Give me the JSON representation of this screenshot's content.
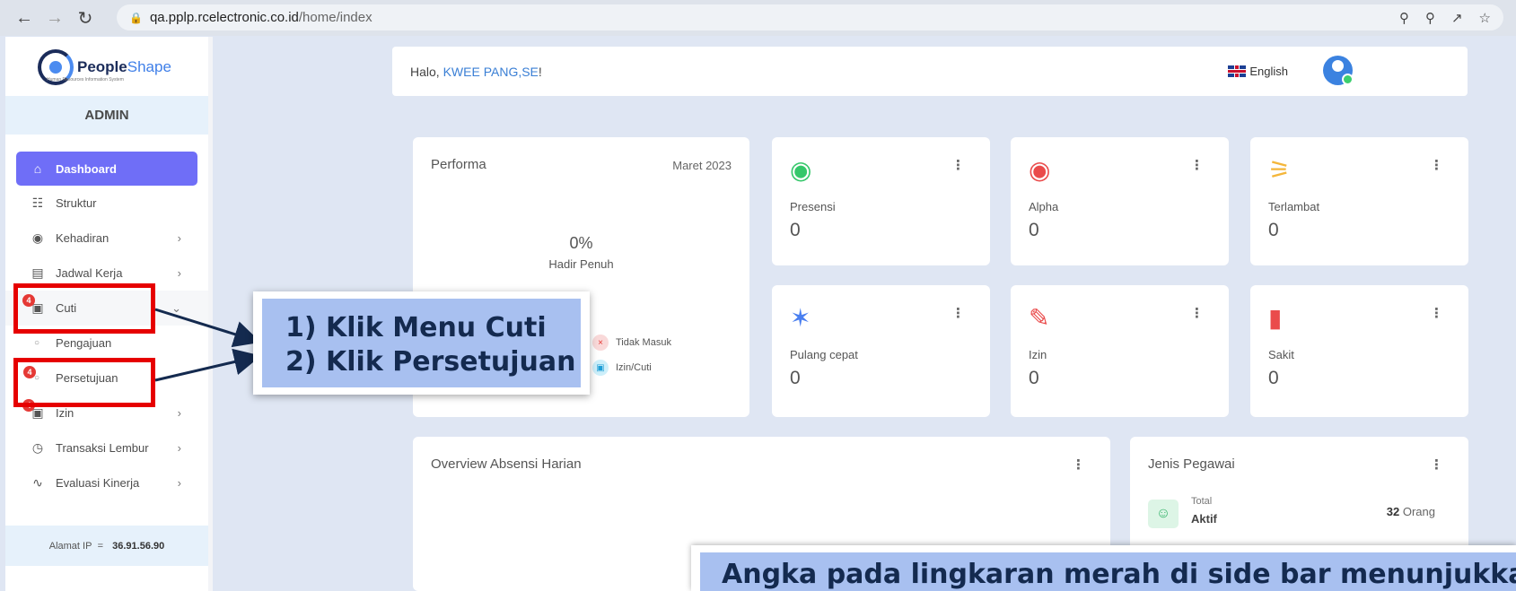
{
  "browser": {
    "url_domain": "qa.pplp.rcelectronic.co.id",
    "url_path": "/home/index"
  },
  "sidebar": {
    "logo_text_a": "People",
    "logo_text_b": "Shape",
    "logo_sub": "Human Resources Information System",
    "role": "ADMIN",
    "items": [
      {
        "label": "Dashboard",
        "icon": "home-icon"
      },
      {
        "label": "Struktur",
        "icon": "org-chart-icon"
      },
      {
        "label": "Kehadiran",
        "icon": "fingerprint-icon"
      },
      {
        "label": "Jadwal Kerja",
        "icon": "briefcase-icon"
      },
      {
        "label": "Cuti",
        "icon": "calendar-icon",
        "badge": "4"
      },
      {
        "label": "Izin",
        "icon": "calendar-icon",
        "badge": "4"
      },
      {
        "label": "Transaksi Lembur",
        "icon": "clock-icon"
      },
      {
        "label": "Evaluasi Kinerja",
        "icon": "chart-line-icon"
      }
    ],
    "cuti_sub": [
      {
        "label": "Pengajuan"
      },
      {
        "label": "Persetujuan",
        "badge": "4"
      }
    ],
    "ip_label": "Alamat IP",
    "ip_sep": "=",
    "ip_value": "36.91.56.90"
  },
  "header": {
    "greeting": "Halo,",
    "user": "KWEE PANG,SE",
    "exclaim": "!",
    "language": "English"
  },
  "performa": {
    "title": "Performa",
    "date": "Maret 2023",
    "percent": "0%",
    "subtitle": "Hadir Penuh",
    "legend": [
      {
        "label": "Tidak Masuk",
        "color": "#f9d9d9"
      },
      {
        "label": "Izin/Cuti",
        "color": "#cdeffa"
      }
    ]
  },
  "stats": [
    {
      "label": "Presensi",
      "value": "0",
      "icon": "fingerprint-check-icon",
      "color": "#35c76a"
    },
    {
      "label": "Alpha",
      "value": "0",
      "icon": "fingerprint-x-icon",
      "color": "#ea4b4b"
    },
    {
      "label": "Terlambat",
      "value": "0",
      "icon": "running-icon",
      "color": "#f4b63a"
    },
    {
      "label": "Pulang cepat",
      "value": "0",
      "icon": "walking-icon",
      "color": "#4a7ff0"
    },
    {
      "label": "Izin",
      "value": "0",
      "icon": "edit-document-icon",
      "color": "#ea4b4b"
    },
    {
      "label": "Sakit",
      "value": "0",
      "icon": "thermometer-icon",
      "color": "#ea4b4b"
    }
  ],
  "overview": {
    "title": "Overview Absensi Harian"
  },
  "jenis_pegawai": {
    "title": "Jenis Pegawai",
    "small": "Total",
    "big": "Aktif",
    "count": "32",
    "unit": "Orang"
  },
  "annotations": {
    "step1": "1) Klik Menu Cuti",
    "step2": "2) Klik Persetujuan",
    "note": "Angka pada lingkaran merah di side bar menunjukkan"
  }
}
